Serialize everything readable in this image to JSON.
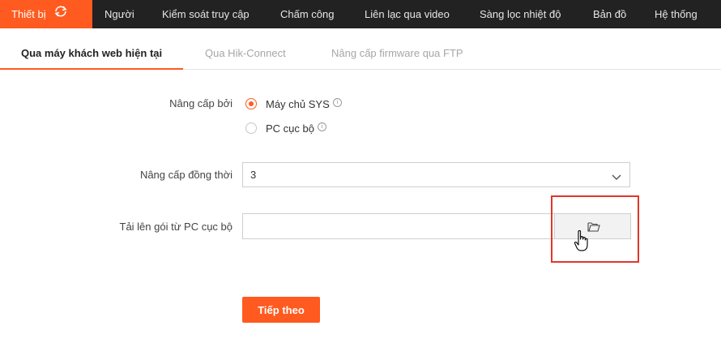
{
  "topnav": {
    "items": [
      {
        "label": "Thiết bị",
        "active": true
      },
      {
        "label": "Người"
      },
      {
        "label": "Kiểm soát truy cập"
      },
      {
        "label": "Chấm công"
      },
      {
        "label": "Liên lạc qua video"
      },
      {
        "label": "Sàng lọc nhiệt độ"
      },
      {
        "label": "Bản đồ"
      },
      {
        "label": "Hệ thống"
      }
    ],
    "active_color": "#ff5a1f",
    "background": "#222222"
  },
  "tabs": [
    {
      "label": "Qua máy khách web hiện tại",
      "active": true
    },
    {
      "label": "Qua Hik-Connect"
    },
    {
      "label": "Nâng cấp firmware qua FTP"
    }
  ],
  "form": {
    "upgrade_by": {
      "label": "Nâng cấp bởi",
      "options": [
        {
          "label": "Máy chủ SYS",
          "checked": true
        },
        {
          "label": "PC cục bộ",
          "checked": false
        }
      ]
    },
    "concurrent": {
      "label": "Nâng cấp đồng thời",
      "value": "3"
    },
    "upload": {
      "label": "Tải lên gói từ PC cục bộ",
      "value": "",
      "browse_icon": "folder-open-icon"
    },
    "next_label": "Tiếp theo"
  }
}
